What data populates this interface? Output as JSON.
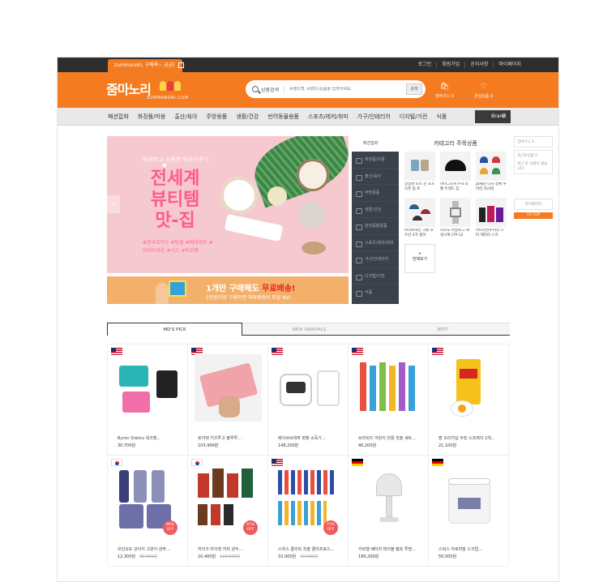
{
  "topbar": {
    "promo_text": "zummanori, 구매욕~ 궁금!",
    "links": [
      "로그인",
      "회원가입",
      "공지사항",
      "마이페이지"
    ]
  },
  "header": {
    "logo_text": "줌마노리",
    "logo_sub": "ZUMMANORI.COM",
    "search_category": "상품검색",
    "search_placeholder": "브랜드명, 브랜드/상품을 입력하세요.",
    "search_button": "검색",
    "cart_label": "장바구니 0",
    "wish_label": "관심상품 0"
  },
  "nav": {
    "items": [
      "패션잡화",
      "화장품/미용",
      "출산/육아",
      "주방용품",
      "생활/건강",
      "반려동물용품",
      "스포츠/레저/취미",
      "가구/인테리어",
      "디지털/가전",
      "식품"
    ],
    "brand_label": "Brand"
  },
  "banner": {
    "subtitle": "피부라고 신중한 피부가꾸기",
    "title_lines": [
      "전세계",
      "뷰티템",
      "맛-집"
    ],
    "tags": "#몽라호이스 #탐클 #베네피트 #바이브라운 #너스 #비오템"
  },
  "strip": {
    "title_prefix": "1개만 구매해도 ",
    "title_highlight": "무료배송!",
    "subtitle": "5만원이상 구매하면 해외배송비 부담 No!"
  },
  "side_categories": {
    "header": "패션잡화",
    "items": [
      "화장품/미용",
      "출산/육아",
      "주방용품",
      "생활/건강",
      "반려동물용품",
      "스포츠/레저/취미",
      "가구/인테리어",
      "디지털/가전",
      "식품"
    ]
  },
  "category_products": {
    "title": "카테고리 주목상품",
    "items": [
      "일일반 토트 인 토트 오픈 탑 토",
      "마이그니아 P-4 라벨 트레드 집",
      "pt패션 나사 말체 투 마리 워시벅",
      "브라보야인 가큐 로 우산 4가 접어",
      "카시오 아날로그 여성시계 LTP-12",
      "아이리컨투어리 스타 캐리어 스치"
    ],
    "more_label": "전체보기"
  },
  "right_side": {
    "recent_title": "장바구니 0",
    "recent_label": "최근본상품 0",
    "recent_empty": "최근 본 상품이 없습니다.",
    "mypage": "마이페이지",
    "to_top": "TO TOP"
  },
  "tabs": [
    "MD'S PICK",
    "NEW ARRIVALS",
    "BEST"
  ],
  "products": [
    {
      "name": "Byron Statics 워크맨...",
      "price": "30,700원",
      "old": "",
      "off": "",
      "flag": "us"
    },
    {
      "name": "로지텍 키즈투고 블루투...",
      "price": "103,400원",
      "old": "",
      "off": "",
      "flag": "us"
    },
    {
      "name": "베이브브레짜 젖병 소독기...",
      "price": "148,200원",
      "old": "",
      "off": "",
      "flag": "us"
    },
    {
      "name": "브라쉬즈 어린이 전용 칫솔 세트...",
      "price": "40,200원",
      "old": "",
      "off": "",
      "flag": "us"
    },
    {
      "name": "팜 오리지널 쿠킹 스프레이 2개...",
      "price": "21,100원",
      "old": "",
      "off": "",
      "flag": "us"
    },
    {
      "name": "유진오또 강아지 고양이 샴푸...",
      "price": "12,300원",
      "old": "90,000원",
      "off": "86% OFF",
      "flag": "kr"
    },
    {
      "name": "하이크 타이엔 커피 원두...",
      "price": "10,400원",
      "old": "110,000원",
      "off": "91% OFF",
      "flag": "kr"
    },
    {
      "name": "스위스 클리틱 칫솔 클리프로스...",
      "price": "10,000원",
      "old": "40,000원",
      "off": "75% OFF",
      "flag": "us"
    },
    {
      "name": "카르텔 배터리 테이블 램프 투명...",
      "price": "190,200원",
      "old": "",
      "off": "",
      "flag": "de"
    },
    {
      "name": "스틱스 아로마말 스크럽...",
      "price": "50,500원",
      "old": "",
      "off": "",
      "flag": "de"
    }
  ],
  "colors": {
    "accent": "#f47b20",
    "dark": "#2e2e2e",
    "pink": "#ff5b8a"
  }
}
